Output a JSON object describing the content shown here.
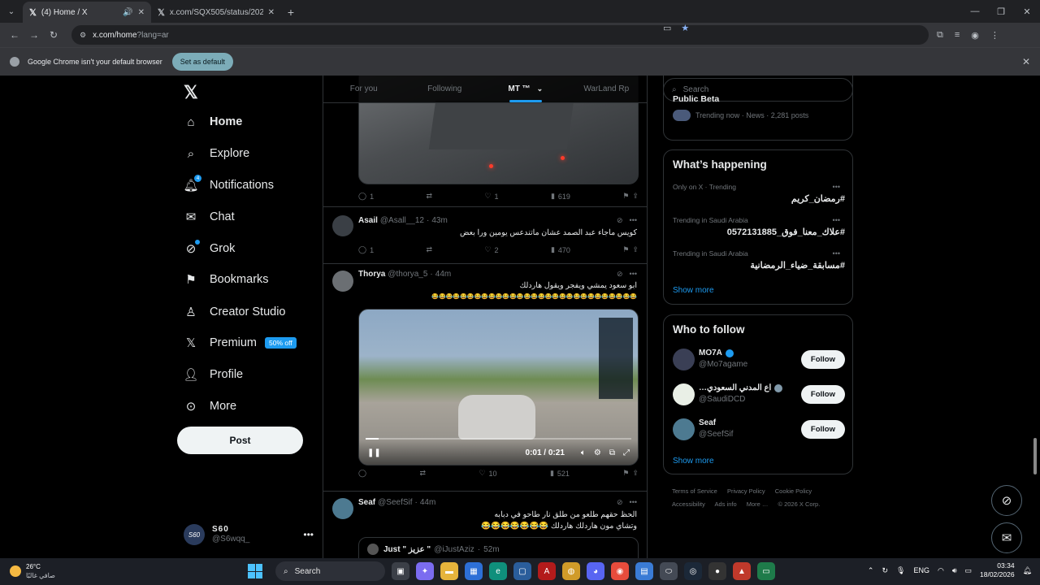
{
  "browser": {
    "tabs": [
      {
        "title": "(4) Home / X",
        "active": true
      },
      {
        "title": "x.com/SQX505/status/202369…",
        "active": false
      }
    ],
    "url_main": "x.com/home",
    "url_query": "?lang=ar",
    "infobar": {
      "message": "Google Chrome isn't your default browser",
      "button": "Set as default"
    }
  },
  "nav": {
    "items": [
      {
        "label": "Home",
        "icon": "home-icon"
      },
      {
        "label": "Explore",
        "icon": "search-icon"
      },
      {
        "label": "Notifications",
        "icon": "bell-icon",
        "badge": "4"
      },
      {
        "label": "Chat",
        "icon": "mail-icon"
      },
      {
        "label": "Grok",
        "icon": "grok-icon"
      },
      {
        "label": "Bookmarks",
        "icon": "bookmark-icon"
      },
      {
        "label": "Creator Studio",
        "icon": "creator-icon"
      },
      {
        "label": "Premium",
        "icon": "x-icon",
        "promo": "50% off"
      },
      {
        "label": "Profile",
        "icon": "person-icon"
      },
      {
        "label": "More",
        "icon": "more-circle-icon"
      }
    ],
    "post_button": "Post",
    "account": {
      "display_name": "S60",
      "handle": "@S6wqq_",
      "avatar_text": "S60"
    }
  },
  "timeline": {
    "tabs": [
      "For you",
      "Following",
      "MT ™",
      "WarLand Rp"
    ],
    "selected_tab": 2,
    "tweets": [
      {
        "metrics": {
          "replies": "1",
          "reposts": "",
          "likes": "1",
          "views": "619"
        }
      },
      {
        "name": "Asail",
        "handle": "@Asall__12",
        "time": "43m",
        "text": "كويس ماجاء عبد الصمد عشان ماتندعس يومين ورا بعض",
        "metrics": {
          "replies": "1",
          "reposts": "",
          "likes": "2",
          "views": "470"
        }
      },
      {
        "name": "Thorya",
        "handle": "@thorya_5",
        "time": "44m",
        "text_line1": "ابو سعود يمشي ويفجر ويقول هاردلك",
        "text_line2": "😂😂😂😂😂😂😂😂😂😂😂😂😂😂😂😂😂😂😂😂😂😂😂😂😂😂😂😂😂",
        "video_time": "0:01 / 0:21",
        "video_progress": 0.05,
        "metrics": {
          "replies": "",
          "reposts": "",
          "likes": "10",
          "views": "521"
        }
      },
      {
        "name": "Seaf",
        "handle": "@SeefSif",
        "time": "44m",
        "text_line1": "الحظ حقهم طلعو من طلق نار طاحو في دبابه",
        "text_line2": "وتشاي مون هاردلك هاردلك 😂😂😂😂😂😂😂",
        "quote": {
          "name": "Just \" عزيز \"",
          "handle": "@iJustAziz",
          "time": "52m"
        }
      }
    ]
  },
  "sidebar": {
    "search_placeholder": "Search",
    "news": {
      "title": "Public Beta",
      "meta": "Trending now · News · 2,281 posts"
    },
    "whats_happening": {
      "title": "What’s happening",
      "trends": [
        {
          "meta": "Only on X · Trending",
          "tag": "#رمضان_كريم"
        },
        {
          "meta": "Trending in Saudi Arabia",
          "tag": "#علاك_معنا_فوق_0572131885"
        },
        {
          "meta": "Trending in Saudi Arabia",
          "tag": "#مسابقة_ضياء_الرمضانية"
        }
      ],
      "show_more": "Show more"
    },
    "who_to_follow": {
      "title": "Who to follow",
      "accounts": [
        {
          "name": "MO7A",
          "handle": "@Mo7agame",
          "verified": "blue"
        },
        {
          "name": "…اع المدني السعودي",
          "handle": "@SaudiDCD",
          "verified": "gray"
        },
        {
          "name": "Seaf",
          "handle": "@SeefSif",
          "verified": ""
        }
      ],
      "follow_label": "Follow",
      "show_more": "Show more"
    },
    "footer": {
      "links": [
        "Terms of Service",
        "Privacy Policy",
        "Cookie Policy",
        "Accessibility",
        "Ads info",
        "More …",
        "© 2026 X Corp."
      ]
    }
  },
  "taskbar": {
    "weather_temp": "26°C",
    "weather_desc": "صافي غالبًا",
    "search_label": "Search",
    "lang": "ENG",
    "time": "03:34",
    "date": "18/02/2026"
  },
  "colors": {
    "accent": "#1d9bf0",
    "background": "#000000",
    "border": "#2f3336",
    "muted_text": "#71767b"
  }
}
